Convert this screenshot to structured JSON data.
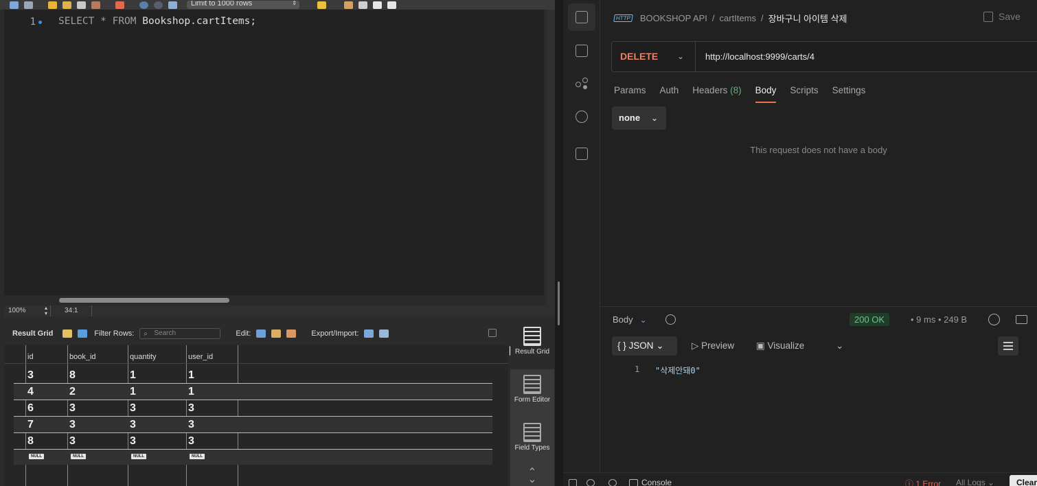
{
  "workbench": {
    "toolbar": {
      "limit_select": "Limit to 1000 rows",
      "icons": [
        "open-file-icon",
        "save-icon",
        "execute-icon",
        "execute-current-icon",
        "explain-icon",
        "stop-icon",
        "toggle-continue-icon",
        "commit-icon",
        "rollback-icon",
        "autocommit-icon",
        "beautify-icon",
        "find-icon",
        "invisible-chars-icon",
        "wrap-icon"
      ]
    },
    "editor": {
      "line_number": "1",
      "code_kw1": "SELECT",
      "code_star": "*",
      "code_kw2": "FROM",
      "code_rest": "Bookshop.cartItems;"
    },
    "status": {
      "zoom": "100%",
      "cursor": "34:1"
    },
    "result_bar": {
      "result_grid_label": "Result Grid",
      "filter_label": "Filter Rows:",
      "search_placeholder": "Search",
      "edit_label": "Edit:",
      "export_label": "Export/Import:"
    },
    "grid": {
      "columns": [
        "id",
        "book_id",
        "quantity",
        "user_id"
      ],
      "rows": [
        [
          "3",
          "8",
          "1",
          "1"
        ],
        [
          "4",
          "2",
          "1",
          "1"
        ],
        [
          "6",
          "3",
          "3",
          "3"
        ],
        [
          "7",
          "3",
          "3",
          "3"
        ],
        [
          "8",
          "3",
          "3",
          "3"
        ]
      ],
      "null_label": "NULL"
    },
    "side_panel": {
      "result_grid": "Result Grid",
      "form_editor": "Form Editor",
      "field_types": "Field Types"
    }
  },
  "postman": {
    "breadcrumb": {
      "badge": "HTTP",
      "collection": "BOOKSHOP API",
      "sep": "/",
      "folder": "cartItems",
      "request": "장바구니 아이템 삭제"
    },
    "save_label": "Save",
    "method": "DELETE",
    "url": "http://localhost:9999/carts/4",
    "tabs": {
      "params": "Params",
      "auth": "Auth",
      "headers": "Headers",
      "headers_count": "(8)",
      "body": "Body",
      "scripts": "Scripts",
      "settings": "Settings"
    },
    "body_type": "none",
    "empty_body_text": "This request does not have a body",
    "response": {
      "tab_label": "Body",
      "status": "200 OK",
      "time": "9 ms",
      "size": "249 B",
      "format": "JSON",
      "preview": "Preview",
      "visualize": "Visualize",
      "line": "1",
      "content": "\"삭제안돼0\""
    },
    "statusbar": {
      "console": "Console",
      "errors": "1 Error",
      "logs": "All Logs",
      "clear": "Clear"
    },
    "accent_color": "#e8734e",
    "status_color": "#6cc58a"
  }
}
